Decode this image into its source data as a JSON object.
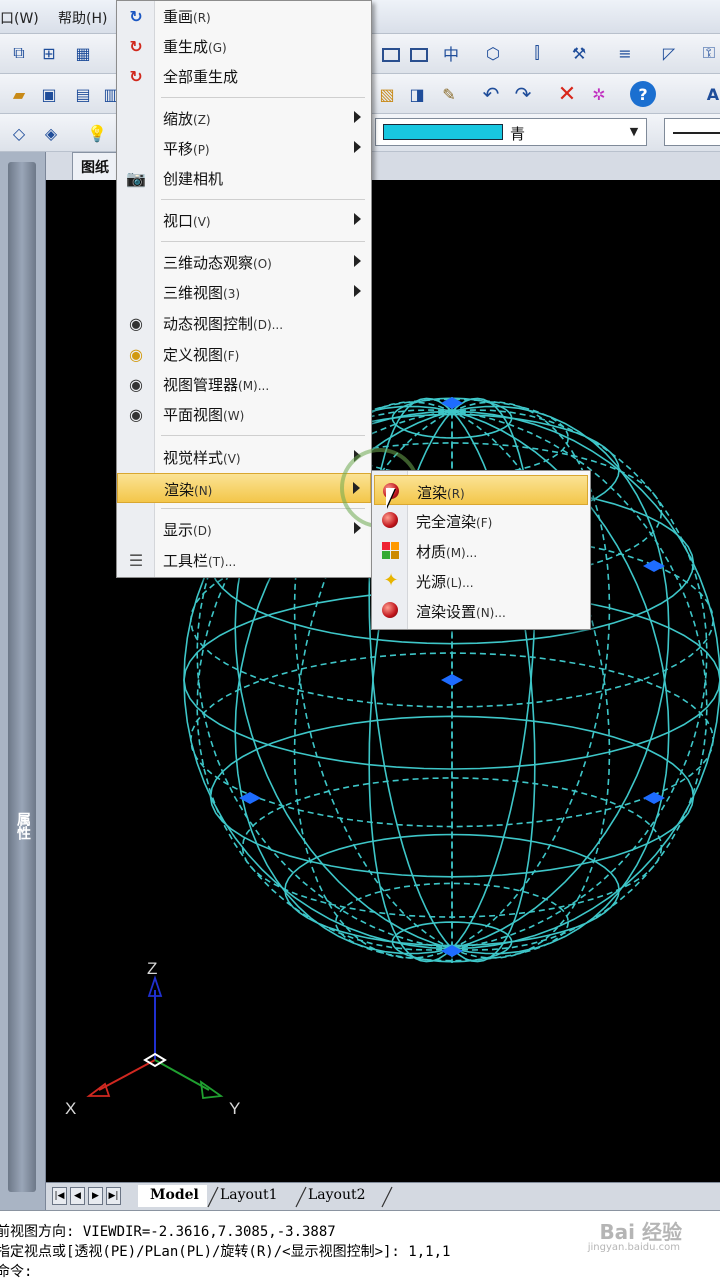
{
  "menubar": {
    "items": [
      "口(W)",
      "帮助(H)"
    ]
  },
  "toolbar": {
    "color_value": "青",
    "color_swatch": "#18c7e0",
    "icons": [
      "redraw-icon",
      "undo-icon",
      "redo-icon",
      "delete-icon",
      "help-icon"
    ]
  },
  "side_panel": {
    "label": "属性"
  },
  "drawing_tab": {
    "label": "图纸"
  },
  "view_menu": {
    "items": [
      {
        "label": "重画",
        "key": "(R)",
        "icon": "redraw-icon",
        "submenu": false
      },
      {
        "label": "重生成",
        "key": "(G)",
        "icon": "regen-icon",
        "submenu": false
      },
      {
        "label": "全部重生成",
        "key": "",
        "icon": "regen-all-icon",
        "submenu": false
      },
      {
        "label": "缩放",
        "key": "(Z)",
        "icon": "",
        "submenu": true
      },
      {
        "label": "平移",
        "key": "(P)",
        "icon": "",
        "submenu": true
      },
      {
        "label": "创建相机",
        "key": "",
        "icon": "camera-icon",
        "submenu": false
      },
      {
        "label": "视口",
        "key": "(V)",
        "icon": "",
        "submenu": true
      },
      {
        "label": "三维动态观察",
        "key": "(O)",
        "icon": "",
        "submenu": true
      },
      {
        "label": "三维视图",
        "key": "(3)",
        "icon": "",
        "submenu": true
      },
      {
        "label": "动态视图控制",
        "key": "(D)...",
        "icon": "dynamic-view-icon",
        "submenu": false
      },
      {
        "label": "定义视图",
        "key": "(F)",
        "icon": "define-view-icon",
        "submenu": false
      },
      {
        "label": "视图管理器",
        "key": "(M)...",
        "icon": "view-manager-icon",
        "submenu": false
      },
      {
        "label": "平面视图",
        "key": "(W)",
        "icon": "plan-view-icon",
        "submenu": false
      },
      {
        "label": "视觉样式",
        "key": "(V)",
        "icon": "",
        "submenu": true
      },
      {
        "label": "渲染",
        "key": "(N)",
        "icon": "",
        "submenu": true
      },
      {
        "label": "显示",
        "key": "(D)",
        "icon": "",
        "submenu": true
      },
      {
        "label": "工具栏",
        "key": "(T)...",
        "icon": "toolbar-icon",
        "submenu": false
      }
    ]
  },
  "render_submenu": {
    "items": [
      {
        "label": "渲染",
        "key": "(R)",
        "icon": "render-icon"
      },
      {
        "label": "完全渲染",
        "key": "(F)",
        "icon": "full-render-icon"
      },
      {
        "label": "材质",
        "key": "(M)...",
        "icon": "material-icon"
      },
      {
        "label": "光源",
        "key": "(L)...",
        "icon": "light-icon"
      },
      {
        "label": "渲染设置",
        "key": "(N)...",
        "icon": "render-settings-icon"
      }
    ]
  },
  "axes": {
    "z": "Z",
    "x": "X",
    "y": "Y"
  },
  "layout_tabs": [
    "Model",
    "Layout1",
    "Layout2"
  ],
  "command_lines": [
    "前视图方向:  VIEWDIR=-2.3616,7.3085,-3.3887",
    "指定视点或[透视(PE)/PLan(PL)/旋转(R)/<显示视图控制>]: 1,1,1",
    "命令:"
  ],
  "watermark": {
    "main": "Bai 经验",
    "sub": "jingyan.baidu.com"
  },
  "wire_color": "#3ec6c8",
  "grip_color": "#1e6cff"
}
